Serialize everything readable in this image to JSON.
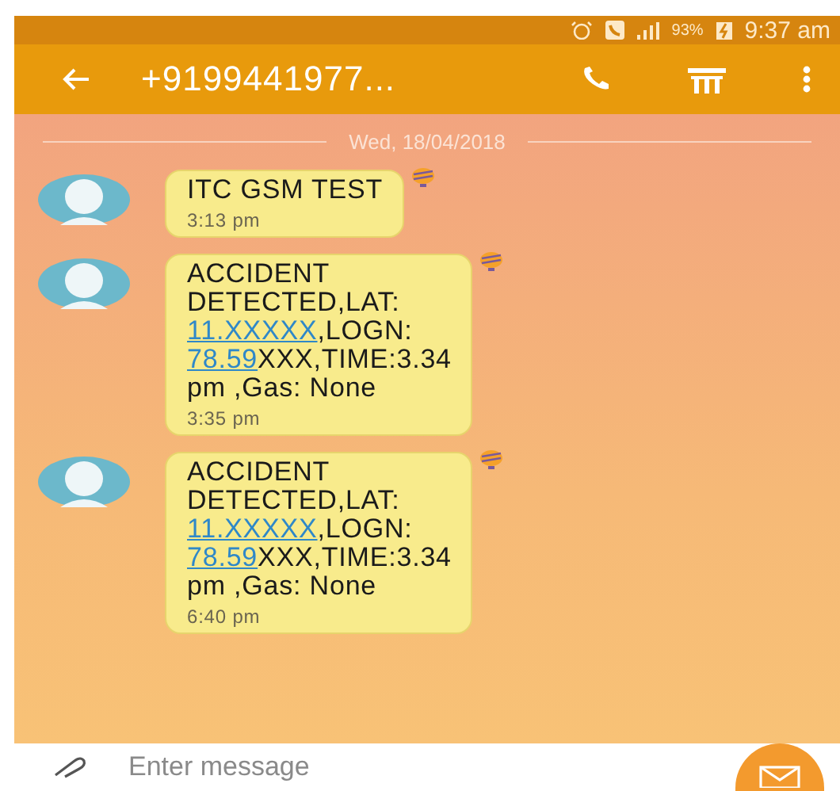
{
  "status_bar": {
    "battery": "93%",
    "time": "9:37 am"
  },
  "app_bar": {
    "title": "+9199441977..."
  },
  "date_divider": "Wed, 18/04/2018",
  "messages": [
    {
      "lines": [
        [
          {
            "text": "ITC GSM TEST",
            "link": false
          }
        ]
      ],
      "time": "3:13 pm"
    },
    {
      "lines": [
        [
          {
            "text": "ACCIDENT",
            "link": false
          }
        ],
        [
          {
            "text": "DETECTED,LAT:",
            "link": false
          }
        ],
        [
          {
            "text": "11.XXXXX",
            "link": true
          },
          {
            "text": ",LOGN:",
            "link": false
          }
        ],
        [
          {
            "text": "78.59",
            "link": true
          },
          {
            "text": "XXX,TIME:3.34",
            "link": false
          }
        ],
        [
          {
            "text": "pm ,Gas: None",
            "link": false
          }
        ]
      ],
      "time": "3:35 pm"
    },
    {
      "lines": [
        [
          {
            "text": "ACCIDENT",
            "link": false
          }
        ],
        [
          {
            "text": "DETECTED,LAT:",
            "link": false
          }
        ],
        [
          {
            "text": "11.XXXXX",
            "link": true
          },
          {
            "text": ",LOGN:",
            "link": false
          }
        ],
        [
          {
            "text": "78.59",
            "link": true
          },
          {
            "text": "XXX,TIME:3.34",
            "link": false
          }
        ],
        [
          {
            "text": "pm ,Gas: None",
            "link": false
          }
        ]
      ],
      "time": "6:40 pm"
    }
  ],
  "composer": {
    "placeholder": "Enter message"
  }
}
